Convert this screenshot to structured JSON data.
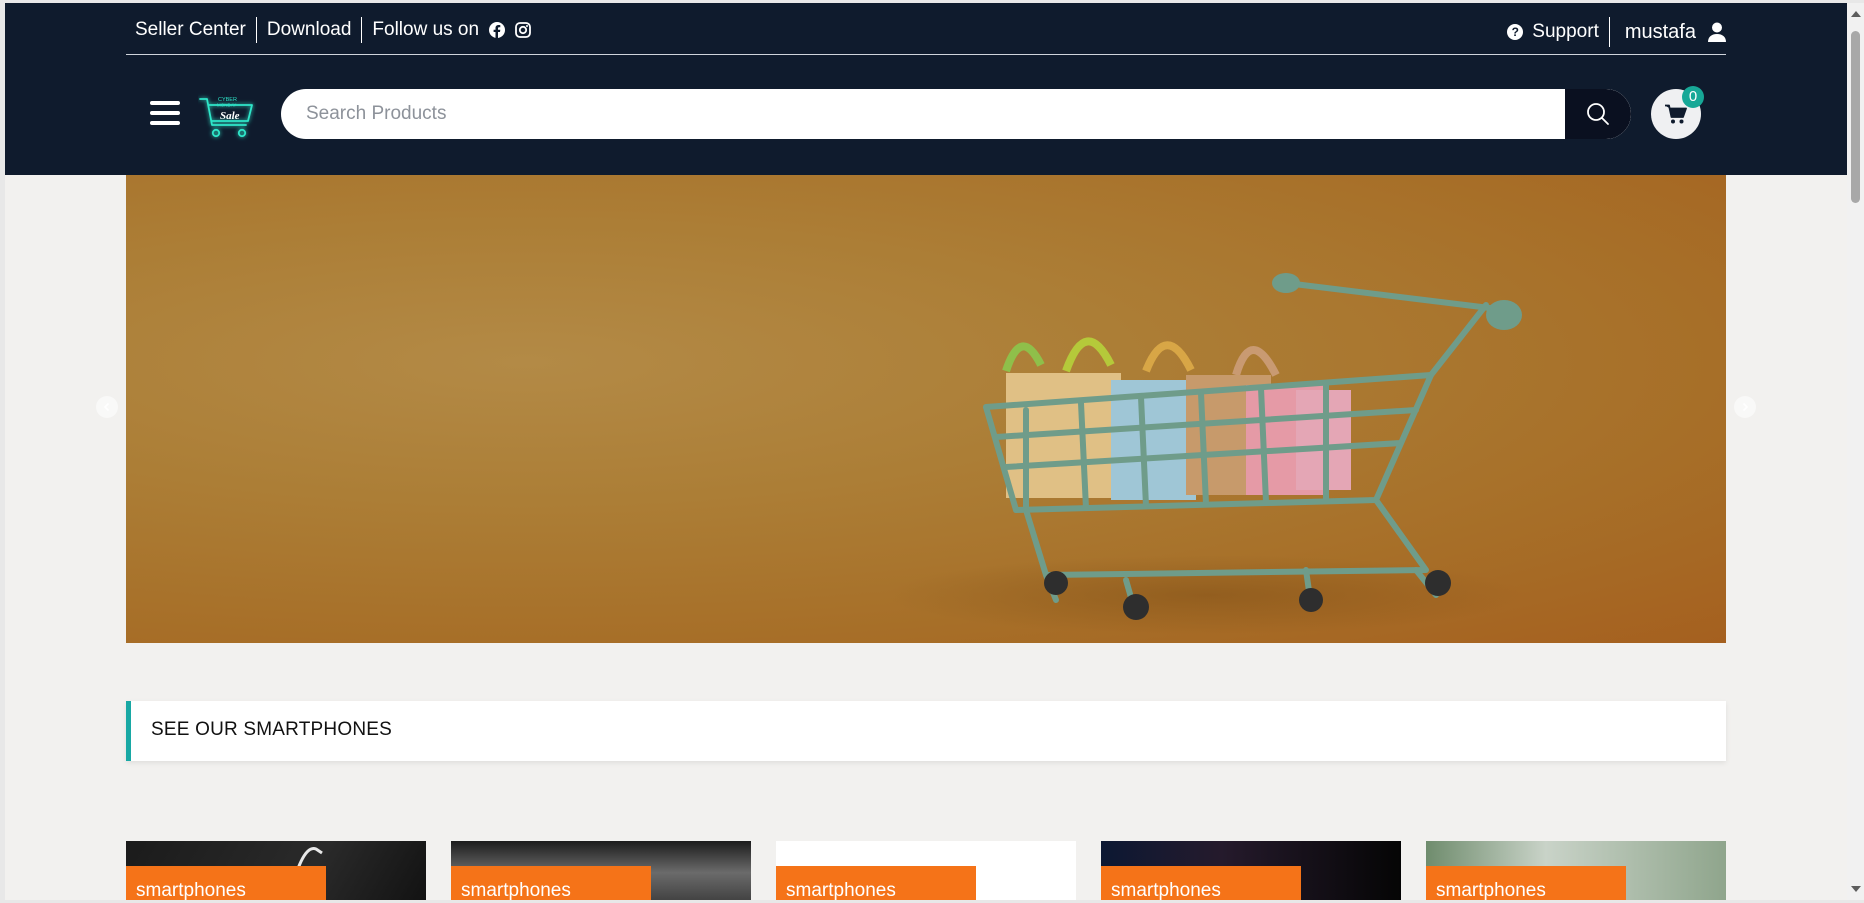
{
  "topbar": {
    "seller_center": "Seller Center",
    "download": "Download",
    "follow_us": "Follow us on",
    "support": "Support",
    "username": "mustafa"
  },
  "search": {
    "placeholder": "Search Products"
  },
  "cart": {
    "count": "0"
  },
  "logo": {
    "line1": "CYBER",
    "line2": "MONDAY",
    "word": "Sale"
  },
  "section": {
    "title": "SEE OUR SMARTPHONES"
  },
  "products": [
    {
      "category": "smartphones"
    },
    {
      "category": "smartphones"
    },
    {
      "category": "smartphones"
    },
    {
      "category": "smartphones"
    },
    {
      "category": "smartphones"
    }
  ],
  "colors": {
    "header_bg": "#0f1b2d",
    "accent_teal": "#18a8a4",
    "tag_orange": "#f57318",
    "page_bg": "#f2f1ef"
  },
  "icons": [
    "menu-icon",
    "facebook-icon",
    "instagram-icon",
    "help-icon",
    "user-icon",
    "search-icon",
    "cart-icon",
    "chevron-left-icon",
    "chevron-right-icon"
  ]
}
